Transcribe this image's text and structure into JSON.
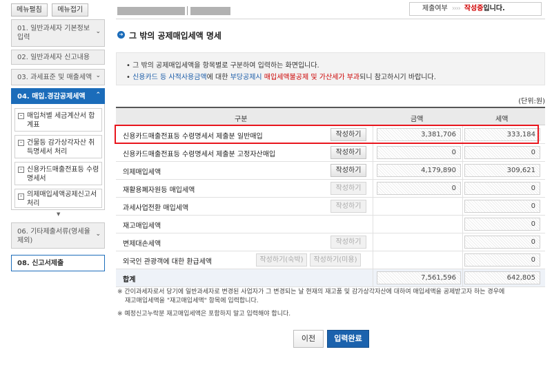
{
  "sidebar": {
    "menu_expand": "메뉴펼침",
    "menu_collapse": "메뉴접기",
    "steps": [
      {
        "label": "01. 일반과세자 기본정보 입력"
      },
      {
        "label": "02. 일반과세자 신고내용"
      },
      {
        "label": "03. 과세표준 및 매출세액"
      },
      {
        "label": "04. 매입.경감공제세액"
      }
    ],
    "sub_items": [
      {
        "label": "매입처별 세금계산서 합계표"
      },
      {
        "label": "건물등 감가상각자산 취득명세서 처리"
      },
      {
        "label": "신용카드매출전표등 수령명세서"
      },
      {
        "label": "의제매입세액공제신고서 처리"
      }
    ],
    "step_06": "06. 기타제출서류(영세율 제외)",
    "step_08": "08. 신고서제출"
  },
  "status": {
    "prefix": "제출여부",
    "arrows": "››››",
    "state": "작성중",
    "suffix": "입니다."
  },
  "page_title": "그 밖의 공제매입세액 명세",
  "notice": {
    "line1": "그 밖의 공제매입세액을 항목별로 구분하여 입력하는 화면입니다.",
    "line2_a": "신용카드 등 사적사용금액",
    "line2_b": "에 대한 ",
    "line2_c": "부당공제시 ",
    "line2_d": "매입세액불공제 및 가산세가 부과",
    "line2_e": "되니 참고하시기 바랍니다."
  },
  "unit": "(단위:원)",
  "table": {
    "headers": {
      "category": "구분",
      "amount": "금액",
      "tax": "세액"
    },
    "rows": [
      {
        "label": "신용카드매출전표등 수령명세서 제출분 일반매입",
        "btn": "작성하기",
        "amount": "3,381,706",
        "tax": "333,184"
      },
      {
        "label": "신용카드매출전표등 수령명세서 제출분 고정자산매입",
        "btn": "작성하기",
        "amount": "0",
        "tax": "0"
      },
      {
        "label": "의제매입세액",
        "btn": "작성하기",
        "amount": "4,179,890",
        "tax": "309,621"
      },
      {
        "label": "재활용폐자원등 매입세액",
        "btn": "작성하기",
        "amount": "0",
        "tax": "0"
      },
      {
        "label": "과세사업전환 매입세액",
        "btn": "작성하기",
        "amount": "",
        "tax": "0"
      },
      {
        "label": "재고매입세액",
        "btn": "",
        "amount": "",
        "tax": "0"
      },
      {
        "label": "변제대손세액",
        "btn": "작성하기",
        "amount": "",
        "tax": "0"
      },
      {
        "label": "외국인 관광객에 대한 환급세액",
        "btn1": "작성하기(숙박)",
        "btn2": "작성하기(미용)",
        "amount": "",
        "tax": "0"
      },
      {
        "label": "합계",
        "amount": "7,561,596",
        "tax": "642,805"
      }
    ]
  },
  "footnotes": {
    "f1_a": "※ 간이과세자로서 당기에 일반과세자로 변경된 사업자가 그 변경되는 날 현재의 재고품 및 감가상각자산에 대하여 매입세액을 공제받고자 하는 경우에",
    "f1_b": "재고매입세액을 \"재고매입세액\" 항목에 입력합니다.",
    "f2": "※ 예정신고누락분 재고매입세액은 포함하지 말고 입력해야 합니다."
  },
  "buttons": {
    "prev": "이전",
    "done": "입력완료"
  },
  "colors": {
    "accent": "#1b6cba",
    "highlight": "#e8141c",
    "warning": "#cc0000"
  }
}
